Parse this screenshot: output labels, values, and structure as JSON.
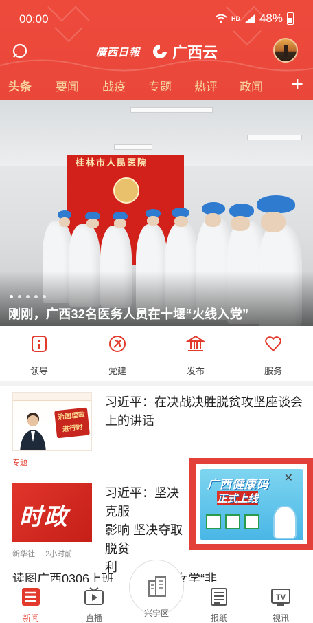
{
  "status_bar": {
    "time": "00:00",
    "network": "HD",
    "battery": "48%"
  },
  "header": {
    "newspaper_name": "廣西日報",
    "brand_name": "广西云",
    "accent_color": "#e9473a",
    "tab_color": "#f7d39f"
  },
  "tabs": [
    {
      "label": "头条"
    },
    {
      "label": "要闻"
    },
    {
      "label": "战疫"
    },
    {
      "label": "专题"
    },
    {
      "label": "热评"
    },
    {
      "label": "政闻"
    }
  ],
  "add_tab_symbol": "+",
  "hero": {
    "banner_text": "桂林市人民医院",
    "caption": "刚刚，广西32名医务人员在十堰“火线入党”",
    "slide_count": 5
  },
  "quick_links": [
    {
      "label": "领导",
      "icon": "info-person-icon"
    },
    {
      "label": "党建",
      "icon": "party-emblem-icon"
    },
    {
      "label": "发布",
      "icon": "building-icon"
    },
    {
      "label": "服务",
      "icon": "heart-icon"
    }
  ],
  "news": [
    {
      "title": "习近平：在决战决胜脱贫攻坚座谈会上的讲话",
      "thumb_text": "治国理政 进行时",
      "meta": [
        "专题"
      ]
    },
    {
      "title": "习近平：坚决克服新冠肺炎疫情影响 坚决夺取脱贫攻坚战全面胜利",
      "title_visible": "习近平：坚决克服\n影响 坚决夺取脱贫\n利",
      "thumb_text": "时政",
      "meta": [
        "新华社",
        "2小时前"
      ]
    }
  ],
  "partial_headline": "读图广西0306上班……三江妇女学“非",
  "ad": {
    "line1": "广西健康码",
    "line2": "正式上线",
    "close": "✕",
    "border_color": "#e3403a"
  },
  "bottom_nav": [
    {
      "label": "新闻",
      "icon": "news-icon",
      "active": true
    },
    {
      "label": "直播",
      "icon": "live-tv-icon",
      "active": false
    },
    {
      "label": "兴宁区",
      "icon": "city-icon",
      "active": false
    },
    {
      "label": "报纸",
      "icon": "newspaper-icon",
      "active": false
    },
    {
      "label": "视讯",
      "icon": "tv-icon",
      "active": false
    }
  ]
}
